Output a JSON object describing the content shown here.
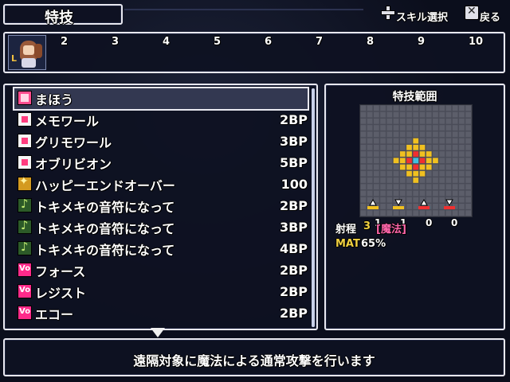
{
  "header": {
    "title": "特技",
    "hint_select_label": "スキル選択",
    "hint_back_label": "戻る",
    "select_icon": "dpad-icon",
    "back_icon": "cancel-button-icon"
  },
  "party": {
    "slots": [
      "2",
      "3",
      "4",
      "5",
      "6",
      "7",
      "8",
      "9",
      "10"
    ],
    "leader_icon": "actor-portrait"
  },
  "skills": [
    {
      "name": "まほう",
      "cost": "",
      "icon": "magic-category-icon",
      "selected": true
    },
    {
      "name": "メモワール",
      "cost": "2BP",
      "icon": "magic-bullet-icon"
    },
    {
      "name": "グリモワール",
      "cost": "3BP",
      "icon": "magic-bullet-icon"
    },
    {
      "name": "オブリビオン",
      "cost": "5BP",
      "icon": "magic-bullet-icon"
    },
    {
      "name": "ハッピーエンドオーバー",
      "cost": "100",
      "icon": "sun-burst-icon"
    },
    {
      "name": "トキメキの音符になって",
      "cost": "2BP",
      "icon": "music-note-icon"
    },
    {
      "name": "トキメキの音符になって",
      "cost": "3BP",
      "icon": "music-note-plus-icon"
    },
    {
      "name": "トキメキの音符になって",
      "cost": "4BP",
      "icon": "music-note-plus2-icon"
    },
    {
      "name": "フォース",
      "cost": "2BP",
      "icon": "vo-icon"
    },
    {
      "name": "レジスト",
      "cost": "2BP",
      "icon": "vo-icon"
    },
    {
      "name": "エコー",
      "cost": "2BP",
      "icon": "vo-icon"
    }
  ],
  "range_panel": {
    "title": "特技範囲",
    "range_label": "射程",
    "range_value": "3",
    "range_type": "[魔法]",
    "mat_label": "MAT",
    "mat_value": "65%",
    "modifiers": [
      "1",
      "1",
      "0",
      "0"
    ],
    "colors": {
      "center": "#40c0e0",
      "inner": "#f03030",
      "outer": "#f0c020",
      "grid": "#4a4c58"
    }
  },
  "description": "遠隔対象に魔法による通常攻撃を行います"
}
